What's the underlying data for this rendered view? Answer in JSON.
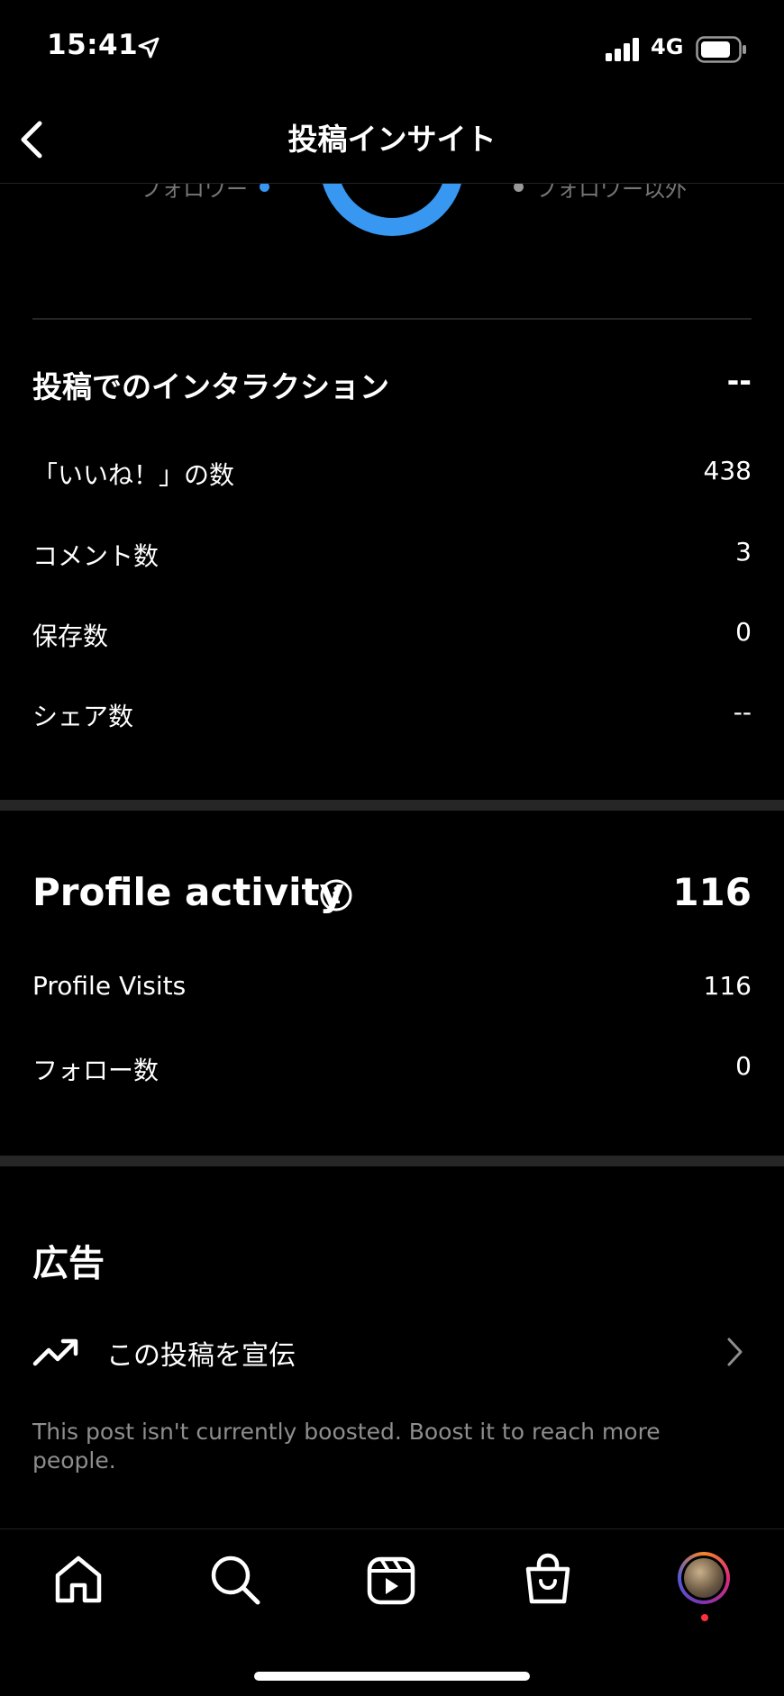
{
  "status_bar": {
    "time": "15:41",
    "network": "4G"
  },
  "header": {
    "title": "投稿インサイト"
  },
  "donut": {
    "left_label": "フォロワー",
    "right_label": "フォロワー以外",
    "color": "#3897f0"
  },
  "interactions": {
    "title": "投稿でのインタラクション",
    "total": "--",
    "rows": [
      {
        "label": "「いいね！」の数",
        "value": "438"
      },
      {
        "label": "コメント数",
        "value": "3"
      },
      {
        "label": "保存数",
        "value": "0"
      },
      {
        "label": "シェア数",
        "value": "--"
      }
    ]
  },
  "profile_activity": {
    "title": "Profile activity",
    "total": "116",
    "rows": [
      {
        "label": "Profile Visits",
        "value": "116"
      },
      {
        "label": "フォロー数",
        "value": "0"
      }
    ]
  },
  "ads": {
    "title": "広告",
    "promote_label": "この投稿を宣伝",
    "note": "This post isn't currently boosted. Boost it to reach more people."
  },
  "tab_bar": {
    "notification_dot_color": "#ff3040"
  }
}
